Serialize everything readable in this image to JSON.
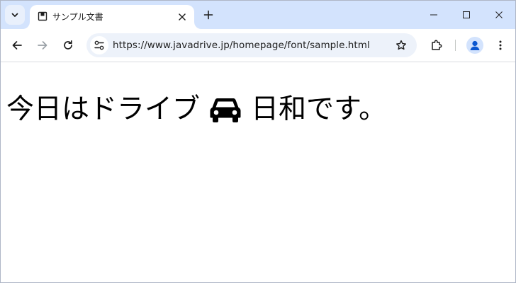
{
  "browser": {
    "tab": {
      "title": "サンプル文書"
    },
    "address_bar": {
      "url": "https://www.javadrive.jp/homepage/font/sample.html"
    }
  },
  "page": {
    "heading_before": "今日はドライブ",
    "heading_after": "日和です。",
    "inline_icon": "car-icon"
  },
  "colors": {
    "tabstrip": "#d3e3fd",
    "omnibox": "#edf2fa",
    "avatar": "#0b57d0"
  }
}
